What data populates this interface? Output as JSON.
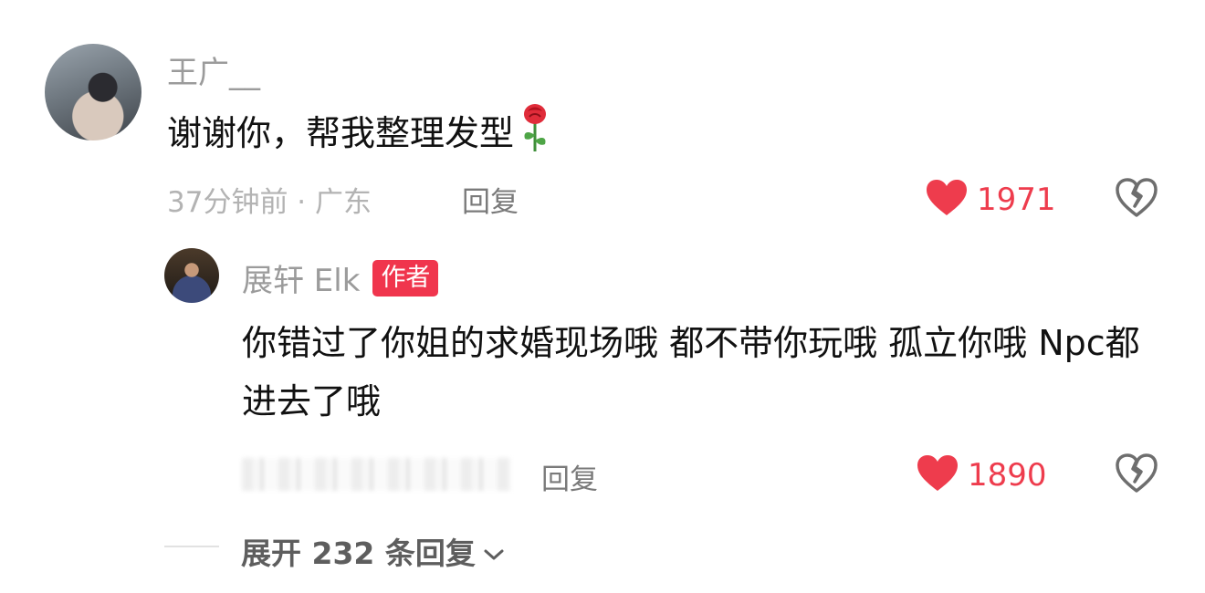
{
  "comment": {
    "username": "王广__",
    "text": "谢谢你，帮我整理发型",
    "emoji_icon": "rose-icon",
    "meta": "37分钟前 · 广东",
    "reply_label": "回复",
    "likes": "1971",
    "like_color": "#ee3c4d"
  },
  "reply": {
    "username": "展轩 Elk",
    "badge": "作者",
    "badge_color": "#f0354d",
    "text": "你错过了你姐的求婚现场哦 都不带你玩哦 孤立你哦 Npc都进去了哦",
    "reply_label": "回复",
    "likes": "1890"
  },
  "expand": {
    "label": "展开 232 条回复"
  }
}
